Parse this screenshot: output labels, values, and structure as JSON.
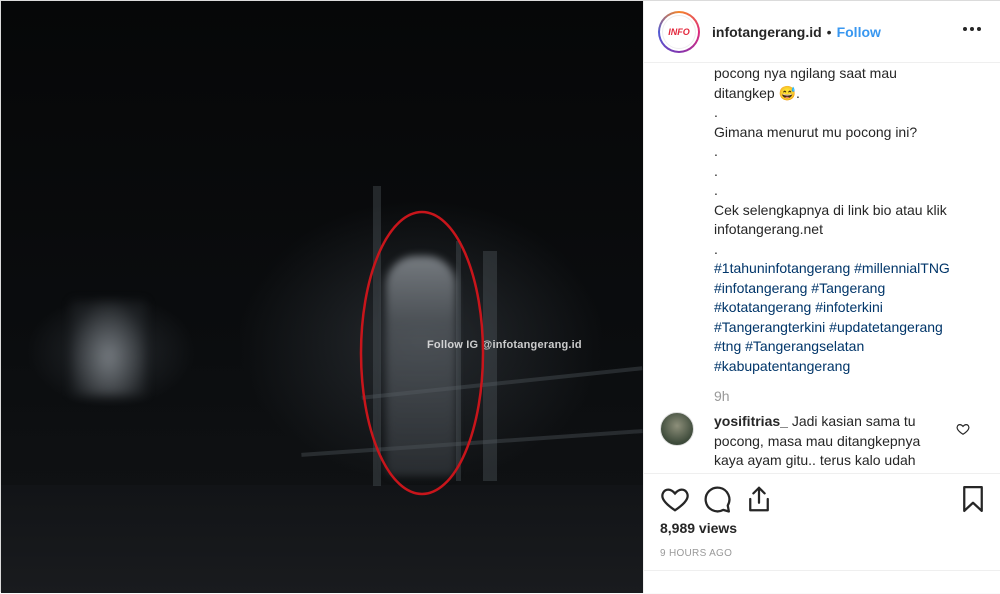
{
  "media": {
    "watermark": "Follow IG @infotangerang.id"
  },
  "header": {
    "avatar_text": "INFO",
    "username": "infotangerang.id",
    "separator": "•",
    "follow_label": "Follow"
  },
  "caption": {
    "lines": [
      {
        "text": "pocong nya ngilang saat mau",
        "kind": "text"
      },
      {
        "text": "ditangkep 😅.",
        "kind": "text"
      },
      {
        "text": ".",
        "kind": "text"
      },
      {
        "text": "Gimana menurut mu pocong ini?",
        "kind": "text"
      },
      {
        "text": ".",
        "kind": "text"
      },
      {
        "text": ".",
        "kind": "text"
      },
      {
        "text": ".",
        "kind": "text"
      },
      {
        "text": "Cek selengkapnya di link bio atau klik",
        "kind": "text"
      },
      {
        "text": "infotangerang.net",
        "kind": "text"
      },
      {
        "text": ".",
        "kind": "text"
      },
      {
        "text": "#1tahuninfotangerang #millennialTNG",
        "kind": "tag"
      },
      {
        "text": "#infotangerang #Tangerang",
        "kind": "tag"
      },
      {
        "text": "#kotatangerang #infoterkini",
        "kind": "tag"
      },
      {
        "text": "#Tangerangterkini #updatetangerang",
        "kind": "tag"
      },
      {
        "text": "#tng #Tangerangselatan",
        "kind": "tag"
      },
      {
        "text": "#kabupatentangerang",
        "kind": "tag"
      }
    ],
    "time_ago": "9h"
  },
  "comment": {
    "username": "yosifitrias_",
    "line1_rest": "Jadi kasian sama tu",
    "line2": "pocong, masa mau ditangkepnya",
    "line3": "kaya ayam gitu.. terus kalo udah"
  },
  "actions": {
    "like_icon": "heart-icon",
    "comment_icon": "comment-icon",
    "share_icon": "share-icon",
    "save_icon": "bookmark-icon",
    "views": "8,989 views",
    "posted": "9 HOURS AGO"
  },
  "colors": {
    "link": "#3897f0",
    "hashtag": "#003569",
    "annotation_circle": "#c8151b"
  }
}
